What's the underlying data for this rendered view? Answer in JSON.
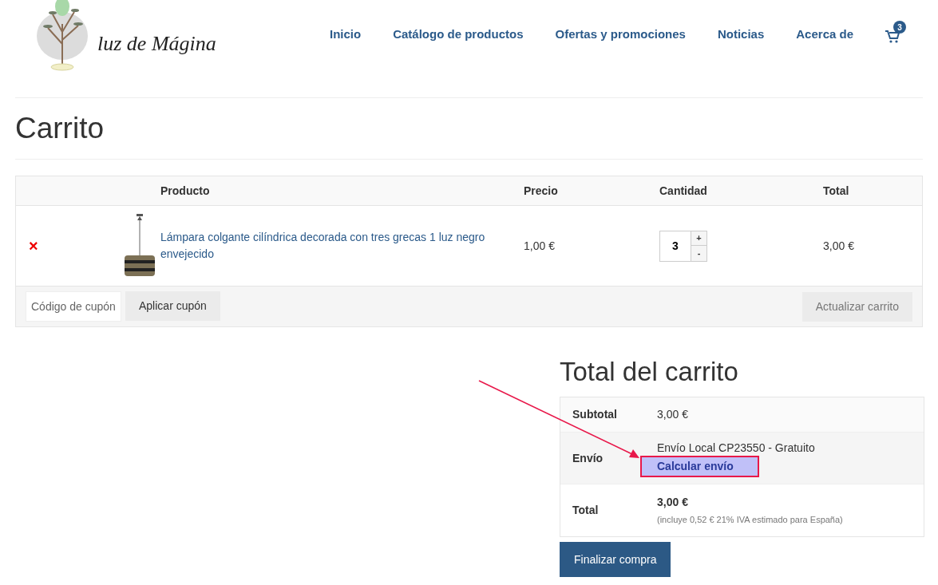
{
  "logo": {
    "text": "luz de Mágina"
  },
  "nav": [
    {
      "label": "Inicio"
    },
    {
      "label": "Catálogo de productos"
    },
    {
      "label": "Ofertas y promociones"
    },
    {
      "label": "Noticias"
    },
    {
      "label": "Acerca de"
    }
  ],
  "cart_count": "3",
  "page_title": "Carrito",
  "cart_table": {
    "columns": [
      "Producto",
      "Precio",
      "Cantidad",
      "Total"
    ],
    "rows": [
      {
        "remove": "×",
        "product": "Lámpara colgante cilíndrica decorada con tres grecas 1 luz negro envejecido",
        "price": "1,00 €",
        "quantity": "3",
        "plus": "+",
        "minus": "-",
        "total": "3,00 €"
      }
    ]
  },
  "coupon": {
    "placeholder": "Código de cupón",
    "apply": "Aplicar cupón",
    "update": "Actualizar carrito"
  },
  "totals": {
    "title": "Total del carrito",
    "rows": [
      {
        "kind": "plain",
        "label": "Subtotal",
        "value": "3,00 €"
      },
      {
        "kind": "shipping",
        "label": "Envío",
        "value": "Envío Local CP23550 - Gratuito",
        "link": "Calcular envío"
      },
      {
        "kind": "total",
        "label": "Total",
        "value": "3,00 €",
        "note": "(incluye 0,52 € 21% IVA estimado para España)"
      }
    ]
  },
  "checkout": "Finalizar compra"
}
